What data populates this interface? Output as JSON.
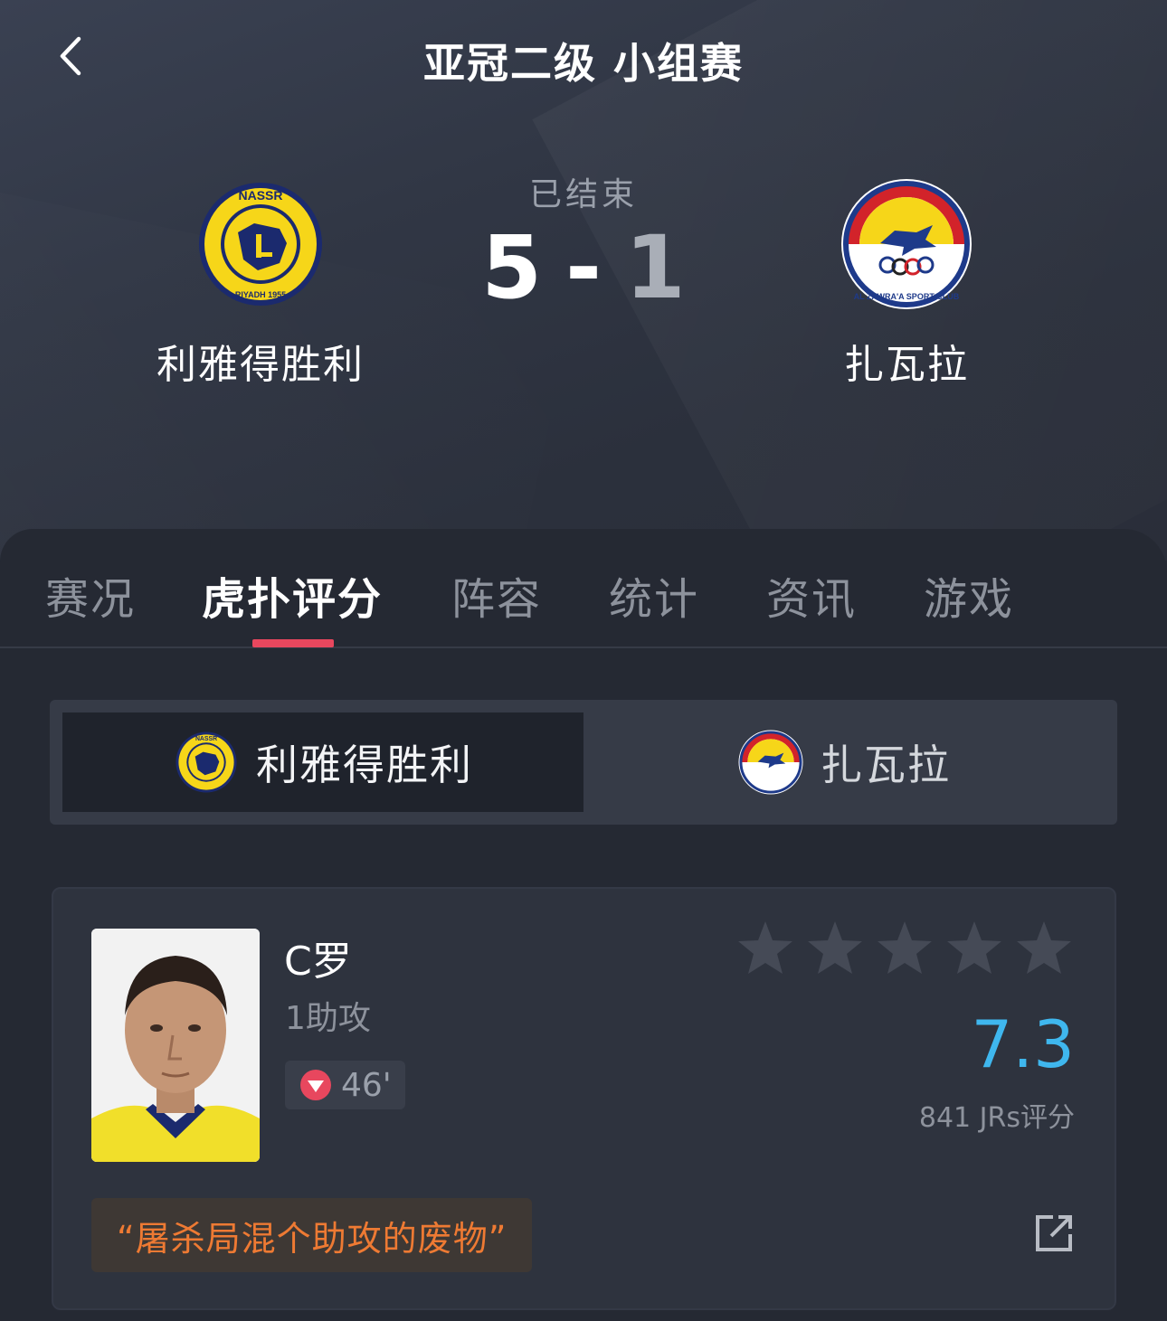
{
  "header": {
    "title": "亚冠二级 小组赛",
    "status": "已结束",
    "home_score": "5",
    "separator": "-",
    "away_score": "1",
    "home_team": {
      "name": "利雅得胜利",
      "crest_text_top": "NASSR",
      "crest_text_bottom": "RIYADH 1955",
      "crest_icon": "al-nassr-crest"
    },
    "away_team": {
      "name": "扎瓦拉",
      "crest_text": "AL ZAWRA'A SPORT CLUB",
      "crest_icon": "al-zawraa-crest"
    }
  },
  "tabs": [
    {
      "label": "赛况",
      "active": false
    },
    {
      "label": "虎扑评分",
      "active": true
    },
    {
      "label": "阵容",
      "active": false
    },
    {
      "label": "统计",
      "active": false
    },
    {
      "label": "资讯",
      "active": false
    },
    {
      "label": "游戏",
      "active": false
    }
  ],
  "team_switch": {
    "left_label": "利雅得胜利",
    "right_label": "扎瓦拉",
    "selected": "left"
  },
  "player": {
    "name": "C罗",
    "stat": "1助攻",
    "sub_off_minute": "46'",
    "sub_icon": "substitution-off-icon",
    "stars_filled": 0,
    "stars_total": 5,
    "rating": "7.3",
    "votes": "841 JRs评分",
    "comment": "“屠杀局混个助攻的废物”",
    "share_icon": "share-external-icon"
  },
  "colors": {
    "accent_red": "#e8475e",
    "rating_blue": "#3fb7ee",
    "comment_orange": "#ee7a33",
    "nassr_yellow": "#f6d619",
    "nassr_navy": "#1b2a6e"
  }
}
